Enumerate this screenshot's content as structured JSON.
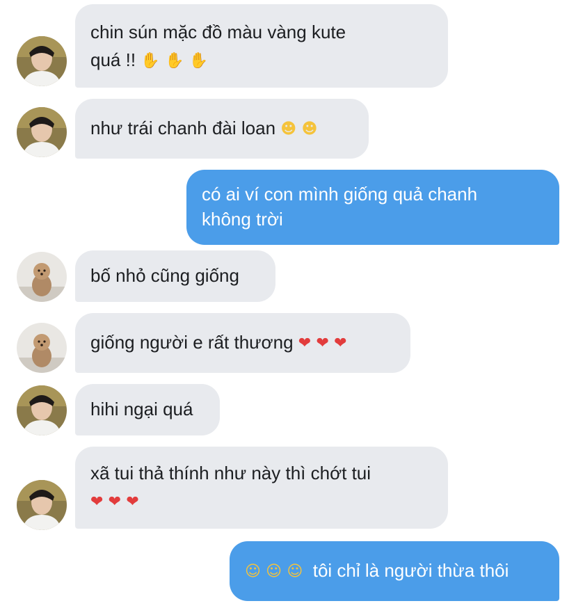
{
  "messages": [
    {
      "id": "m1",
      "from": "user-a",
      "avatar": "person",
      "text_line1": "chin sún mặc đồ màu vàng kute",
      "text_line2": "quá !!",
      "emojis": [
        "heart-hands",
        "heart-hands",
        "heart-hands"
      ]
    },
    {
      "id": "m2",
      "from": "user-a",
      "avatar": "person",
      "text": "như trái chanh đài loan",
      "emojis": [
        "grinning-face",
        "grinning-face"
      ]
    },
    {
      "id": "m3",
      "from": "me",
      "text_line1": "có ai ví con mình giống quả chanh",
      "text_line2": "không trời"
    },
    {
      "id": "m4",
      "from": "user-b",
      "avatar": "dog",
      "text": "bố nhỏ cũng giống"
    },
    {
      "id": "m5",
      "from": "user-b",
      "avatar": "dog",
      "text": "giống người e rất thương",
      "emojis": [
        "red-heart",
        "red-heart",
        "red-heart"
      ]
    },
    {
      "id": "m6",
      "from": "user-a",
      "avatar": "person",
      "text": "hihi ngại quá"
    },
    {
      "id": "m7",
      "from": "user-a",
      "avatar": "person",
      "text_line1": "xã tui thả thính như này thì chớt tui",
      "emojis": [
        "red-heart",
        "red-heart",
        "red-heart"
      ]
    },
    {
      "id": "m8",
      "from": "me",
      "text": "tôi chỉ là người thừa thôi",
      "emojis": [
        "slightly-smiling-face",
        "slightly-smiling-face",
        "slightly-smiling-face"
      ]
    }
  ],
  "glyphs": {
    "heart-hands": "🫶",
    "grinning-face": "☻",
    "red-heart": "❤",
    "slightly-smiling-face": "☺"
  },
  "colors": {
    "incoming_bubble": "#e8eaee",
    "outgoing_bubble": "#4b9de9",
    "heart": "#e23c3c"
  }
}
